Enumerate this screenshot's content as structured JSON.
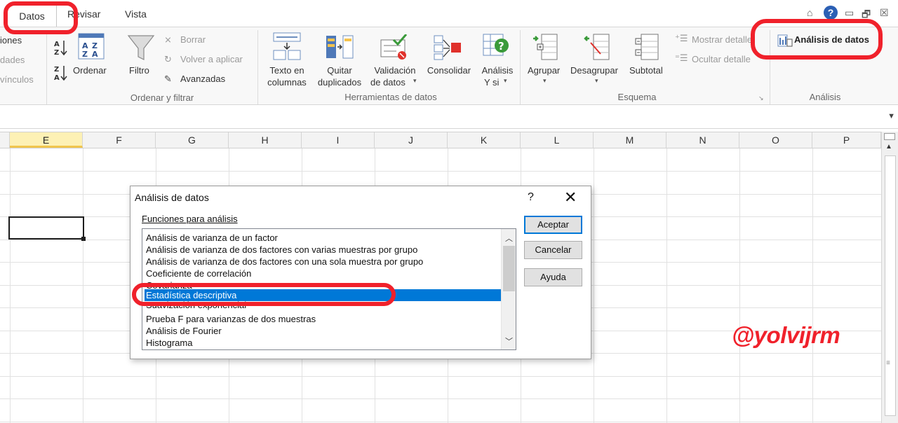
{
  "tabs": {
    "datos": "Datos",
    "revisar": "Revisar",
    "vista": "Vista"
  },
  "window_controls": {
    "expand": "⌂",
    "help": "?",
    "minimize": "▭",
    "restore": "🗗",
    "close": "☒"
  },
  "ribbon": {
    "left_partial": {
      "item1": "iones",
      "item2": "dades",
      "item3": "vínculos"
    },
    "sort_filter": {
      "ordenar": "Ordenar",
      "filtro": "Filtro",
      "borrar": "Borrar",
      "volver_a_aplicar": "Volver a aplicar",
      "avanzadas": "Avanzadas",
      "group_label": "Ordenar y filtrar"
    },
    "data_tools": {
      "texto_en_columnas_1": "Texto en",
      "texto_en_columnas_2": "columnas",
      "quitar_duplicados_1": "Quitar",
      "quitar_duplicados_2": "duplicados",
      "validacion_1": "Validación",
      "validacion_2": "de datos",
      "consolidar": "Consolidar",
      "analisis_y_si_1": "Análisis",
      "analisis_y_si_2": "Y si",
      "group_label": "Herramientas de datos"
    },
    "outline": {
      "agrupar": "Agrupar",
      "desagrupar": "Desagrupar",
      "subtotal": "Subtotal",
      "mostrar_detalle": "Mostrar detalle",
      "ocultar_detalle": "Ocultar detalle",
      "group_label": "Esquema"
    },
    "analysis": {
      "analisis_de_datos": "Análisis de datos",
      "group_label": "Análisis"
    }
  },
  "columns": [
    "E",
    "F",
    "G",
    "H",
    "I",
    "J",
    "K",
    "L",
    "M",
    "N",
    "O",
    "P"
  ],
  "dialog": {
    "title": "Análisis de datos",
    "help": "?",
    "close": "✕",
    "functions_label": "Funciones para análisis",
    "items": [
      "Análisis de varianza de un factor",
      "Análisis de varianza de dos factores con varias muestras por grupo",
      "Análisis de varianza de dos factores con una sola muestra por grupo",
      "Coeficiente de correlación",
      "Covarianza",
      "Estadística descriptiva",
      "Suavización exponencial",
      "Prueba F para varianzas de dos muestras",
      "Análisis de Fourier",
      "Histograma"
    ],
    "selected_item": "Estadística descriptiva",
    "buttons": {
      "aceptar": "Aceptar",
      "cancelar": "Cancelar",
      "ayuda": "Ayuda"
    }
  },
  "watermark": "@yolvijrm",
  "colors": {
    "annotation": "#f0212b",
    "selection": "#0078d7",
    "active_column": "#fdf1b5"
  }
}
